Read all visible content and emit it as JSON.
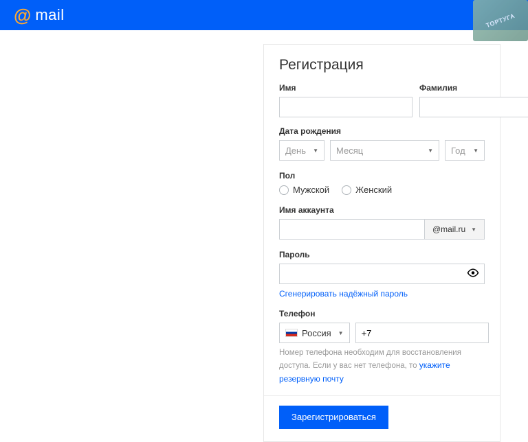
{
  "header": {
    "logo_text": "mail",
    "watermark": "ТОРТУГА"
  },
  "form": {
    "title": "Регистрация",
    "first_name_label": "Имя",
    "last_name_label": "Фамилия",
    "dob_label": "Дата рождения",
    "dob_day": "День",
    "dob_month": "Месяц",
    "dob_year": "Год",
    "gender_label": "Пол",
    "gender_male": "Мужской",
    "gender_female": "Женский",
    "account_label": "Имя аккаунта",
    "domain": "@mail.ru",
    "password_label": "Пароль",
    "gen_password": "Сгенерировать надёжный пароль",
    "phone_label": "Телефон",
    "country": "Россия",
    "phone_prefix": "+7",
    "hint_part1": "Номер телефона необходим для восстановления доступа. Если у вас нет телефона, то ",
    "hint_link": "укажите резервную почту",
    "submit": "Зарегистрироваться"
  }
}
